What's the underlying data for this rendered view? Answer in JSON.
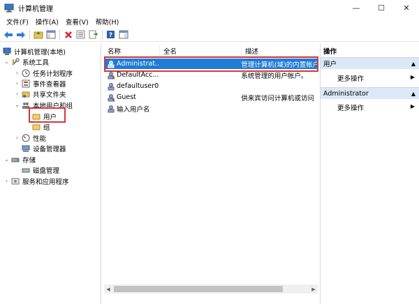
{
  "window": {
    "title": "计算机管理",
    "minimize": "—",
    "maximize": "☐",
    "close": "✕"
  },
  "menu": [
    "文件(F)",
    "操作(A)",
    "查看(V)",
    "帮助(H)"
  ],
  "toolbar_icons": [
    "back-arrow-icon",
    "forward-arrow-icon",
    "up-folder-icon",
    "show-hide-tree-icon",
    "delete-icon",
    "properties-icon",
    "export-list-icon",
    "help-icon",
    "console-tree-icon"
  ],
  "tree": {
    "root": "计算机管理(本地)",
    "system_tools": "系统工具",
    "task_scheduler": "任务计划程序",
    "event_viewer": "事件查看器",
    "shared_folders": "共享文件夹",
    "local_users_groups": "本地用户和组",
    "users": "用户",
    "groups": "组",
    "performance": "性能",
    "device_manager": "设备管理器",
    "storage": "存储",
    "disk_management": "磁盘管理",
    "services_apps": "服务和应用程序"
  },
  "list": {
    "headers": [
      "名称",
      "全名",
      "描述"
    ],
    "rows": [
      {
        "name": "Administrat...",
        "fullname": "",
        "desc": "管理计算机(域)的内置帐户"
      },
      {
        "name": "DefaultAcc...",
        "fullname": "",
        "desc": "系统管理的用户帐户。"
      },
      {
        "name": "defaultuser0",
        "fullname": "",
        "desc": ""
      },
      {
        "name": "Guest",
        "fullname": "",
        "desc": "供来宾访问计算机或访问"
      },
      {
        "name": "输入用户名",
        "fullname": "",
        "desc": ""
      }
    ]
  },
  "actions": {
    "title": "操作",
    "section1": "用户",
    "more1": "更多操作",
    "section2": "Administrator",
    "more2": "更多操作"
  }
}
